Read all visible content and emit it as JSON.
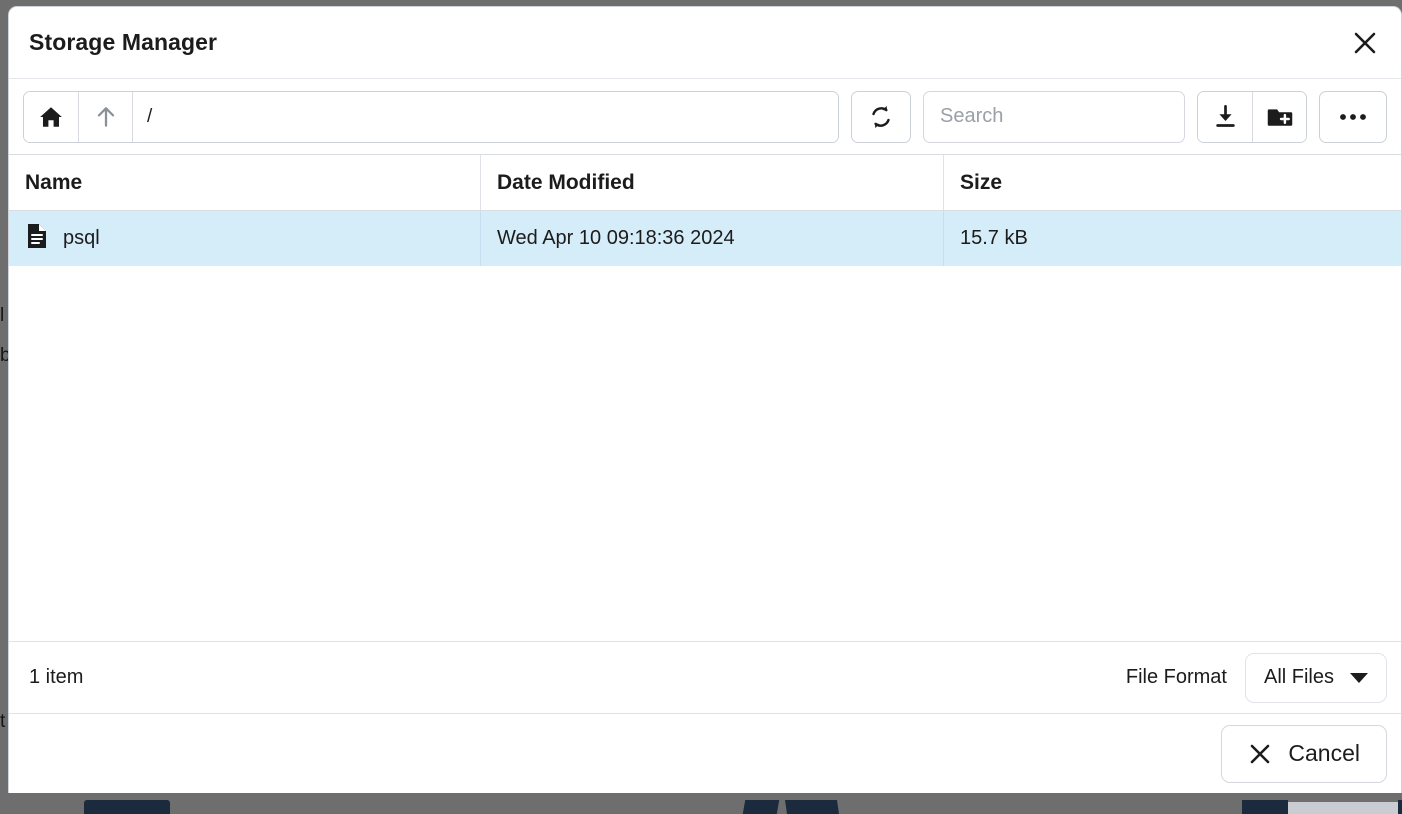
{
  "window": {
    "title": "Storage Manager",
    "close_icon": "close-icon"
  },
  "toolbar": {
    "home_icon": "home-icon",
    "up_icon": "arrow-up-icon",
    "path_value": "/",
    "refresh_icon": "refresh-icon",
    "search": {
      "placeholder": "Search",
      "value": ""
    },
    "download_icon": "download-icon",
    "new_folder_icon": "new-folder-icon",
    "more_icon": "more-options-icon"
  },
  "table": {
    "columns": [
      {
        "key": "name",
        "label": "Name"
      },
      {
        "key": "date",
        "label": "Date Modified"
      },
      {
        "key": "size",
        "label": "Size"
      }
    ],
    "rows": [
      {
        "icon": "file-icon",
        "name": "psql",
        "date": "Wed Apr 10 09:18:36 2024",
        "size": "15.7 kB",
        "selected": true
      }
    ]
  },
  "status": {
    "item_count": "1 item",
    "format_label": "File Format",
    "format_value": "All Files"
  },
  "actions": {
    "cancel_label": "Cancel",
    "cancel_icon": "close-icon"
  },
  "colors": {
    "backdrop": "#6e6e6e",
    "dialog_bg": "#ffffff",
    "selected_row": "#d5ecf9",
    "border": "#d9dde2",
    "text": "#1c1c1c",
    "muted_text": "#9aa0a8",
    "backdrop_accent": "#1b2a3d"
  }
}
